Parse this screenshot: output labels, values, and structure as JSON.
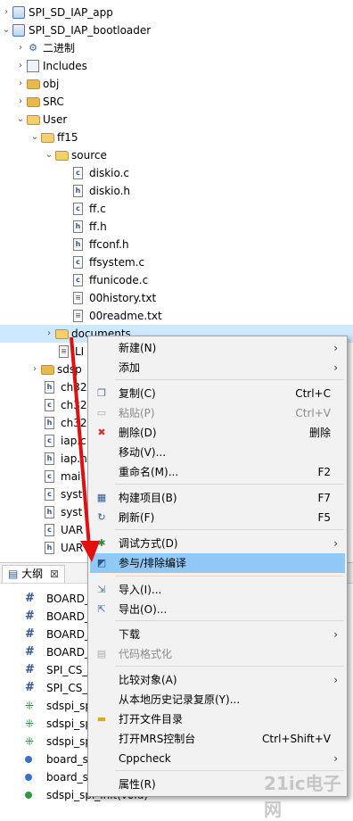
{
  "tree": {
    "items": [
      {
        "label": "SPI_SD_IAP_app",
        "icon": "project-icon"
      },
      {
        "label": "SPI_SD_IAP_bootloader",
        "icon": "project-icon"
      },
      {
        "label": "二进制",
        "icon": "binaries-icon"
      },
      {
        "label": "Includes",
        "icon": "includes-icon"
      },
      {
        "label": "obj",
        "icon": "folder-icon"
      },
      {
        "label": "SRC",
        "icon": "folder-icon"
      },
      {
        "label": "User",
        "icon": "folder-open-icon"
      },
      {
        "label": "ff15",
        "icon": "folder-open-icon"
      },
      {
        "label": "source",
        "icon": "folder-open-icon"
      },
      {
        "label": "diskio.c",
        "icon": "c-file-icon"
      },
      {
        "label": "diskio.h",
        "icon": "h-file-icon"
      },
      {
        "label": "ff.c",
        "icon": "c-file-icon"
      },
      {
        "label": "ff.h",
        "icon": "h-file-icon"
      },
      {
        "label": "ffconf.h",
        "icon": "h-file-icon"
      },
      {
        "label": "ffsystem.c",
        "icon": "c-file-icon"
      },
      {
        "label": "ffunicode.c",
        "icon": "c-file-icon"
      },
      {
        "label": "00history.txt",
        "icon": "text-file-icon"
      },
      {
        "label": "00readme.txt",
        "icon": "text-file-icon"
      },
      {
        "label": "documents",
        "icon": "folder-open-icon"
      },
      {
        "label": "LI",
        "icon": "text-file-icon"
      },
      {
        "label": "sdsp",
        "icon": "folder-icon"
      },
      {
        "label": "ch32",
        "icon": "h-file-icon"
      },
      {
        "label": "ch32",
        "icon": "c-file-icon"
      },
      {
        "label": "ch32",
        "icon": "h-file-icon"
      },
      {
        "label": "iap.c",
        "icon": "c-file-icon"
      },
      {
        "label": "iap.h",
        "icon": "h-file-icon"
      },
      {
        "label": "mai",
        "icon": "c-file-icon"
      },
      {
        "label": "syst",
        "icon": "c-file-icon"
      },
      {
        "label": "syst",
        "icon": "h-file-icon"
      },
      {
        "label": "UAR",
        "icon": "c-file-icon"
      },
      {
        "label": "UAR",
        "icon": "h-file-icon"
      }
    ]
  },
  "outline": {
    "tab_label": "大纲",
    "close_glyph": "⊠",
    "items": [
      {
        "label": "BOARD_",
        "icon": "define-icon"
      },
      {
        "label": "BOARD_",
        "icon": "define-icon"
      },
      {
        "label": "BOARD_",
        "icon": "define-icon"
      },
      {
        "label": "BOARD_",
        "icon": "define-icon"
      },
      {
        "label": "SPI_CS_",
        "icon": "define-icon"
      },
      {
        "label": "SPI_CS_",
        "icon": "define-icon"
      },
      {
        "label": "sdspi_sp",
        "icon": "function-decl-icon"
      },
      {
        "label": "sdspi_sp",
        "icon": "function-decl-icon"
      },
      {
        "label": "sdspi_sp",
        "icon": "function-decl-icon"
      },
      {
        "label": "board_s",
        "icon": "static-function-icon"
      },
      {
        "label": "board_s",
        "icon": "function-icon"
      },
      {
        "label": "sdspi_spi_init(void)",
        "icon": "function-icon"
      }
    ]
  },
  "menu": {
    "items": [
      {
        "label": "新建(N)",
        "shortcut": "",
        "submenu": true,
        "disabled": false,
        "icon": ""
      },
      {
        "label": "添加",
        "shortcut": "",
        "submenu": true,
        "disabled": false,
        "icon": ""
      },
      {
        "label": "复制(C)",
        "shortcut": "Ctrl+C",
        "submenu": false,
        "disabled": false,
        "icon": "copy-icon"
      },
      {
        "label": "粘贴(P)",
        "shortcut": "Ctrl+V",
        "submenu": false,
        "disabled": true,
        "icon": "paste-icon"
      },
      {
        "label": "删除(D)",
        "shortcut": "删除",
        "submenu": false,
        "disabled": false,
        "icon": "delete-icon"
      },
      {
        "label": "移动(V)...",
        "shortcut": "",
        "submenu": false,
        "disabled": false,
        "icon": ""
      },
      {
        "label": "重命名(M)...",
        "shortcut": "F2",
        "submenu": false,
        "disabled": false,
        "icon": ""
      },
      {
        "label": "构建项目(B)",
        "shortcut": "F7",
        "submenu": false,
        "disabled": false,
        "icon": "build-icon"
      },
      {
        "label": "刷新(F)",
        "shortcut": "F5",
        "submenu": false,
        "disabled": false,
        "icon": "refresh-icon"
      },
      {
        "label": "调试方式(D)",
        "shortcut": "",
        "submenu": true,
        "disabled": false,
        "icon": "debug-icon"
      },
      {
        "label": "参与/排除编译",
        "shortcut": "",
        "submenu": false,
        "disabled": false,
        "icon": "include-exclude-icon"
      },
      {
        "label": "导入(I)...",
        "shortcut": "",
        "submenu": false,
        "disabled": false,
        "icon": "import-icon"
      },
      {
        "label": "导出(O)...",
        "shortcut": "",
        "submenu": false,
        "disabled": false,
        "icon": "export-icon"
      },
      {
        "label": "下载",
        "shortcut": "",
        "submenu": true,
        "disabled": false,
        "icon": ""
      },
      {
        "label": "代码格式化",
        "shortcut": "",
        "submenu": false,
        "disabled": true,
        "icon": "format-icon"
      },
      {
        "label": "比较对象(A)",
        "shortcut": "",
        "submenu": true,
        "disabled": false,
        "icon": ""
      },
      {
        "label": "从本地历史记录复原(Y)...",
        "shortcut": "",
        "submenu": false,
        "disabled": false,
        "icon": ""
      },
      {
        "label": "打开文件目录",
        "shortcut": "",
        "submenu": false,
        "disabled": false,
        "icon": "open-folder-icon"
      },
      {
        "label": "打开MRS控制台",
        "shortcut": "Ctrl+Shift+V",
        "submenu": false,
        "disabled": false,
        "icon": ""
      },
      {
        "label": "Cppcheck",
        "shortcut": "",
        "submenu": true,
        "disabled": false,
        "icon": ""
      },
      {
        "label": "属性(R)",
        "shortcut": "",
        "submenu": false,
        "disabled": false,
        "icon": ""
      }
    ],
    "submenu_glyph": "›"
  },
  "watermark": "21ic电子网",
  "colors": {
    "highlight": "#90c8f6",
    "arrow": "#e01010",
    "selection": "#cde8ff"
  }
}
